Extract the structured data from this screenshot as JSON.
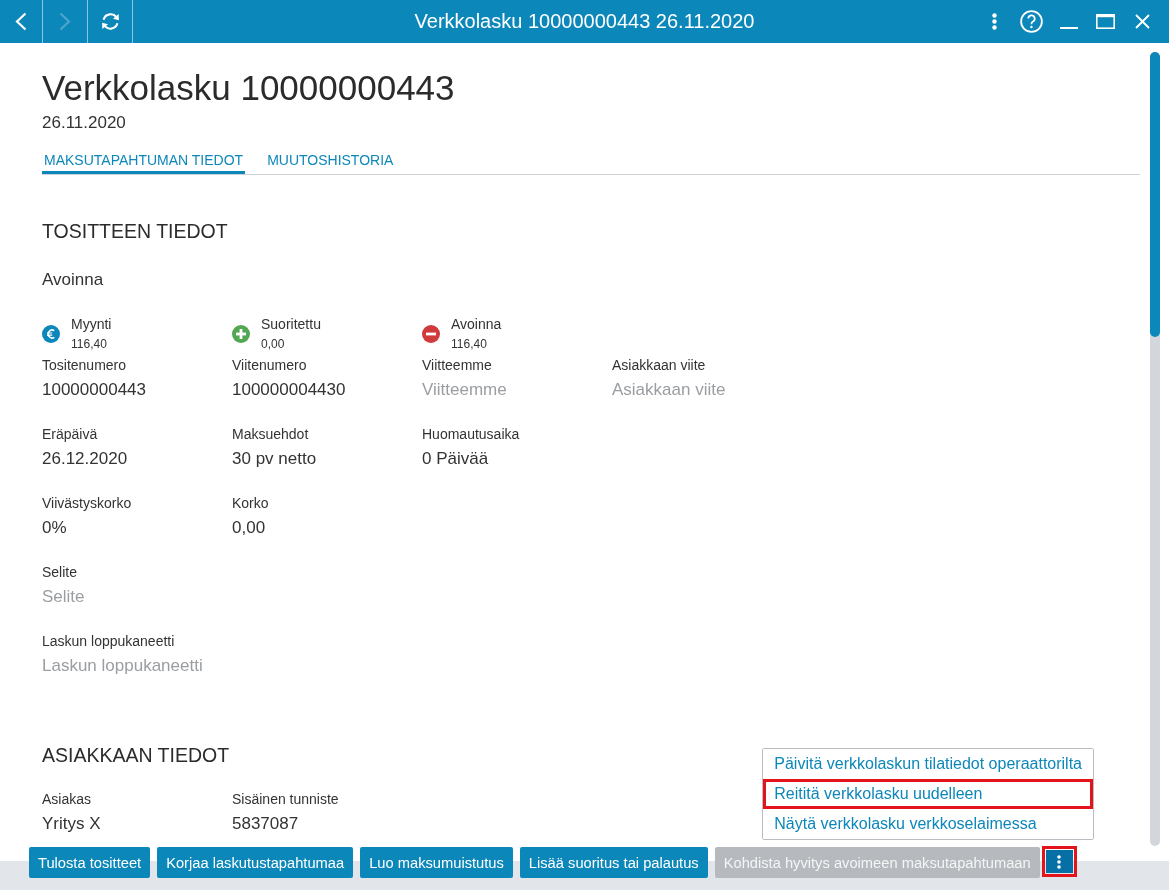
{
  "window": {
    "title": "Verkkolasku 10000000443 26.11.2020",
    "nav": [
      {
        "kind": "back",
        "disabled": false
      },
      {
        "kind": "forward",
        "disabled": true
      },
      {
        "kind": "refresh",
        "disabled": false
      }
    ],
    "controls": [
      {
        "kind": "more"
      },
      {
        "kind": "help"
      },
      {
        "kind": "minimize"
      },
      {
        "kind": "maximize"
      },
      {
        "kind": "close"
      }
    ]
  },
  "header": {
    "title": "Verkkolasku 10000000443",
    "date": "26.11.2020"
  },
  "tabs": [
    {
      "label": "MAKSUTAPAHTUMAN TIEDOT",
      "selected": true
    },
    {
      "label": "MUUTOSHISTORIA",
      "selected": false
    }
  ],
  "sections": [
    {
      "title": "TOSITTEEN TIEDOT",
      "status": "Avoinna",
      "summary": [
        {
          "kind": "euro",
          "label": "Myynti",
          "value": "116,40",
          "color": "#0c87ba"
        },
        {
          "kind": "plus",
          "label": "Suoritettu",
          "value": "0,00",
          "color": "#52a752"
        },
        {
          "kind": "minus",
          "label": "Avoinna",
          "value": "116,40",
          "color": "#d13a3a"
        }
      ],
      "rows": [
        [
          {
            "label": "Tositenumero",
            "value": "10000000443"
          },
          {
            "label": "Viitenumero",
            "value": "100000004430"
          },
          {
            "label": "Viitteemme",
            "placeholder": "Viitteemme"
          },
          {
            "label": "Asiakkaan viite",
            "placeholder": "Asiakkaan viite"
          }
        ],
        [
          {
            "label": "Eräpäivä",
            "value": "26.12.2020"
          },
          {
            "label": "Maksuehdot",
            "value": "30 pv netto"
          },
          {
            "label": "Huomautusaika",
            "value": "0 Päivää"
          }
        ],
        [
          {
            "label": "Viivästyskorko",
            "value": "0%"
          },
          {
            "label": "Korko",
            "value": "0,00"
          }
        ],
        [
          {
            "label": "Selite",
            "placeholder": "Selite"
          }
        ],
        [
          {
            "label": "Laskun loppukaneetti",
            "placeholder": "Laskun loppukaneetti"
          }
        ]
      ]
    },
    {
      "title": "ASIAKKAAN TIEDOT",
      "rows": [
        [
          {
            "label": "Asiakas",
            "value": "Yritys X"
          },
          {
            "label": "Sisäinen tunniste",
            "value": "5837087"
          }
        ]
      ]
    }
  ],
  "actions": [
    {
      "label": "Tulosta tositteet",
      "disabled": false
    },
    {
      "label": "Korjaa laskutustapahtumaa",
      "disabled": false
    },
    {
      "label": "Luo maksumuistutus",
      "disabled": false
    },
    {
      "label": "Lisää suoritus tai palautus",
      "disabled": false
    },
    {
      "label": "Kohdista hyvitys avoimeen maksutapahtumaan",
      "disabled": true
    }
  ],
  "more_button": {
    "expanded": true,
    "highlighted": true,
    "menu": [
      {
        "label": "Päivitä verkkolaskun tilatiedot operaattorilta",
        "highlighted": false
      },
      {
        "label": "Reititä verkkolasku uudelleen",
        "highlighted": true
      },
      {
        "label": "Näytä verkkolasku verkkoselaimessa",
        "highlighted": false
      }
    ]
  }
}
